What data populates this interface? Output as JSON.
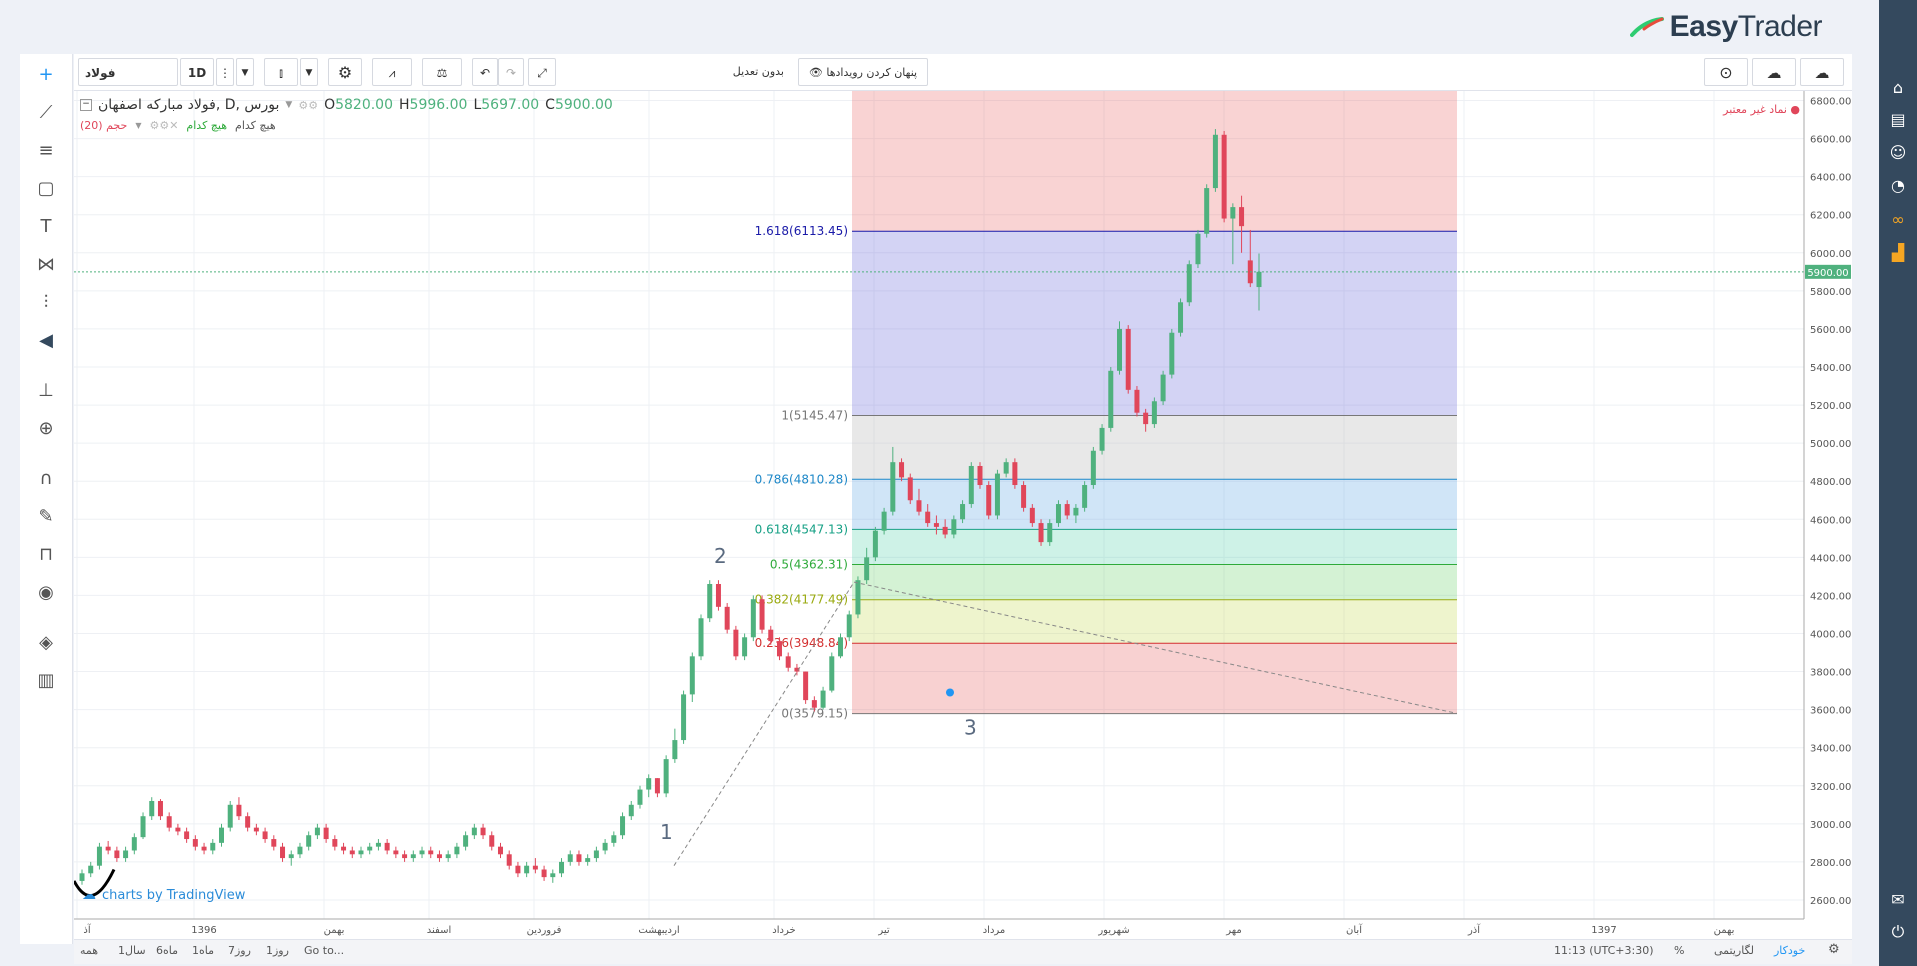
{
  "app": {
    "brand_light": "Easy",
    "brand_bold": "Trader",
    "brand_color": "#2c3e50"
  },
  "toolbar": {
    "symbol": "فولاد",
    "interval": "1D",
    "adjust_label": "بدون تعدیل",
    "hide_events_label": "پنهان کردن رویدادها"
  },
  "legend": {
    "title": "فولاد مبارکه اصفهان, D, بورس",
    "open_label": "O",
    "open": "5820.00",
    "high_label": "H",
    "high": "5996.00",
    "low_label": "L",
    "low": "5697.00",
    "close_label": "C",
    "close": "5900.00",
    "volume_label": "حجم (20)",
    "volume_a": "هیچ کدام",
    "volume_b": "هیچ کدام",
    "invalid_symbol": "نماد غیر معتبر"
  },
  "watermark": "charts by TradingView",
  "waves": [
    "1",
    "2",
    "3"
  ],
  "chart_data": {
    "type": "candlestick",
    "ylim": [
      2500,
      6850
    ],
    "y_ticks": [
      2600,
      2800,
      3000,
      3200,
      3400,
      3600,
      3800,
      4000,
      4200,
      4400,
      4600,
      4800,
      5000,
      5200,
      5400,
      5600,
      5800,
      6000,
      6200,
      6400,
      6600,
      6800
    ],
    "y_tick_labels": [
      "2600.00",
      "2800.00",
      "3000.00",
      "3200.00",
      "3400.00",
      "3600.00",
      "3800.00",
      "4000.00",
      "4200.00",
      "4400.00",
      "4600.00",
      "4800.00",
      "5000.00",
      "5200.00",
      "5400.00",
      "5600.00",
      "5800.00",
      "6000.00",
      "6200.00",
      "6400.00",
      "6600.00",
      "6800.00"
    ],
    "last_price": 5900,
    "last_price_label": "5900.00",
    "x_labels": [
      "آذ",
      "1396",
      "بهمن",
      "اسفند",
      "فروردین",
      "اردیبهشت",
      "خرداد",
      "تیر",
      "مرداد",
      "شهریور",
      "مهر",
      "آبان",
      "آذر",
      "1397",
      "بهمن"
    ],
    "fibonacci": [
      {
        "label": "1.618(6113.45)",
        "value": 6113.45,
        "color": "#1a1aa8"
      },
      {
        "label": "1(5145.47)",
        "value": 5145.47,
        "color": "#777777"
      },
      {
        "label": "0.786(4810.28)",
        "value": 4810.28,
        "color": "#1e88c8"
      },
      {
        "label": "0.618(4547.13)",
        "value": 4547.13,
        "color": "#16a085"
      },
      {
        "label": "0.5(4362.31)",
        "value": 4362.31,
        "color": "#2eaa3a"
      },
      {
        "label": "0.382(4177.49)",
        "value": 4177.49,
        "color": "#9aaa10"
      },
      {
        "label": "0.236(3948.84)",
        "value": 3948.84,
        "color": "#d32f2f"
      },
      {
        "label": "0(3579.15)",
        "value": 3579.15,
        "color": "#777777"
      }
    ],
    "candles": [
      [
        2700,
        2760,
        2680,
        2740
      ],
      [
        2740,
        2800,
        2720,
        2780
      ],
      [
        2780,
        2900,
        2760,
        2880
      ],
      [
        2880,
        2910,
        2840,
        2860
      ],
      [
        2860,
        2880,
        2800,
        2820
      ],
      [
        2820,
        2880,
        2800,
        2860
      ],
      [
        2860,
        2950,
        2840,
        2930
      ],
      [
        2930,
        3060,
        2920,
        3040
      ],
      [
        3040,
        3140,
        3020,
        3120
      ],
      [
        3120,
        3130,
        3020,
        3040
      ],
      [
        3040,
        3060,
        2960,
        2980
      ],
      [
        2980,
        3000,
        2940,
        2960
      ],
      [
        2960,
        2980,
        2900,
        2920
      ],
      [
        2920,
        2940,
        2860,
        2880
      ],
      [
        2880,
        2900,
        2840,
        2860
      ],
      [
        2860,
        2920,
        2840,
        2900
      ],
      [
        2900,
        3000,
        2880,
        2980
      ],
      [
        2980,
        3120,
        2960,
        3100
      ],
      [
        3100,
        3140,
        3020,
        3040
      ],
      [
        3040,
        3060,
        2960,
        2980
      ],
      [
        2980,
        3000,
        2940,
        2960
      ],
      [
        2960,
        2980,
        2900,
        2920
      ],
      [
        2920,
        2940,
        2860,
        2880
      ],
      [
        2880,
        2900,
        2800,
        2820
      ],
      [
        2820,
        2860,
        2780,
        2840
      ],
      [
        2840,
        2900,
        2820,
        2880
      ],
      [
        2880,
        2960,
        2860,
        2940
      ],
      [
        2940,
        3000,
        2920,
        2980
      ],
      [
        2980,
        3000,
        2900,
        2920
      ],
      [
        2920,
        2940,
        2860,
        2880
      ],
      [
        2880,
        2900,
        2840,
        2860
      ],
      [
        2860,
        2880,
        2820,
        2840
      ],
      [
        2840,
        2880,
        2820,
        2860
      ],
      [
        2860,
        2900,
        2840,
        2880
      ],
      [
        2880,
        2920,
        2860,
        2900
      ],
      [
        2900,
        2920,
        2840,
        2860
      ],
      [
        2860,
        2880,
        2820,
        2840
      ],
      [
        2840,
        2860,
        2800,
        2820
      ],
      [
        2820,
        2860,
        2800,
        2840
      ],
      [
        2840,
        2880,
        2820,
        2860
      ],
      [
        2860,
        2880,
        2820,
        2840
      ],
      [
        2840,
        2860,
        2800,
        2820
      ],
      [
        2820,
        2860,
        2800,
        2840
      ],
      [
        2840,
        2900,
        2820,
        2880
      ],
      [
        2880,
        2960,
        2860,
        2940
      ],
      [
        2940,
        3000,
        2920,
        2980
      ],
      [
        2980,
        3000,
        2920,
        2940
      ],
      [
        2940,
        2960,
        2860,
        2880
      ],
      [
        2880,
        2900,
        2820,
        2840
      ],
      [
        2840,
        2860,
        2760,
        2780
      ],
      [
        2780,
        2800,
        2720,
        2740
      ],
      [
        2740,
        2800,
        2720,
        2780
      ],
      [
        2780,
        2820,
        2740,
        2760
      ],
      [
        2760,
        2780,
        2700,
        2720
      ],
      [
        2720,
        2760,
        2690,
        2740
      ],
      [
        2740,
        2820,
        2720,
        2800
      ],
      [
        2800,
        2860,
        2780,
        2840
      ],
      [
        2840,
        2860,
        2780,
        2800
      ],
      [
        2800,
        2840,
        2780,
        2820
      ],
      [
        2820,
        2880,
        2800,
        2860
      ],
      [
        2860,
        2920,
        2840,
        2900
      ],
      [
        2900,
        2960,
        2880,
        2940
      ],
      [
        2940,
        3060,
        2920,
        3040
      ],
      [
        3040,
        3120,
        3020,
        3100
      ],
      [
        3100,
        3200,
        3080,
        3180
      ],
      [
        3180,
        3260,
        3140,
        3240
      ],
      [
        3240,
        3240,
        3140,
        3160
      ],
      [
        3160,
        3360,
        3140,
        3340
      ],
      [
        3340,
        3500,
        3320,
        3440
      ],
      [
        3440,
        3700,
        3420,
        3680
      ],
      [
        3680,
        3900,
        3640,
        3880
      ],
      [
        3880,
        4100,
        3860,
        4080
      ],
      [
        4080,
        4280,
        4060,
        4260
      ],
      [
        4260,
        4280,
        4120,
        4140
      ],
      [
        4140,
        4160,
        4000,
        4020
      ],
      [
        4020,
        4040,
        3860,
        3880
      ],
      [
        3880,
        4000,
        3860,
        3980
      ],
      [
        3980,
        4200,
        3960,
        4180
      ],
      [
        4180,
        4200,
        4000,
        4020
      ],
      [
        4020,
        4040,
        3940,
        3960
      ],
      [
        3960,
        3980,
        3860,
        3880
      ],
      [
        3880,
        3900,
        3800,
        3820
      ],
      [
        3820,
        3840,
        3780,
        3800
      ],
      [
        3800,
        3800,
        3630,
        3650
      ],
      [
        3650,
        3670,
        3590,
        3610
      ],
      [
        3610,
        3720,
        3600,
        3700
      ],
      [
        3700,
        3900,
        3690,
        3880
      ],
      [
        3880,
        4000,
        3870,
        3980
      ],
      [
        3980,
        4120,
        3960,
        4100
      ],
      [
        4100,
        4300,
        4080,
        4280
      ],
      [
        4280,
        4450,
        4260,
        4400
      ],
      [
        4400,
        4560,
        4380,
        4540
      ],
      [
        4540,
        4660,
        4520,
        4640
      ],
      [
        4640,
        4980,
        4620,
        4900
      ],
      [
        4900,
        4920,
        4800,
        4820
      ],
      [
        4820,
        4840,
        4680,
        4700
      ],
      [
        4700,
        4760,
        4620,
        4640
      ],
      [
        4640,
        4680,
        4560,
        4580
      ],
      [
        4580,
        4620,
        4520,
        4560
      ],
      [
        4560,
        4600,
        4500,
        4520
      ],
      [
        4520,
        4620,
        4500,
        4600
      ],
      [
        4600,
        4700,
        4580,
        4680
      ],
      [
        4680,
        4900,
        4660,
        4880
      ],
      [
        4880,
        4900,
        4760,
        4780
      ],
      [
        4780,
        4800,
        4600,
        4620
      ],
      [
        4620,
        4860,
        4600,
        4840
      ],
      [
        4840,
        4920,
        4820,
        4900
      ],
      [
        4900,
        4920,
        4760,
        4780
      ],
      [
        4780,
        4800,
        4640,
        4660
      ],
      [
        4660,
        4680,
        4560,
        4580
      ],
      [
        4580,
        4600,
        4460,
        4480
      ],
      [
        4480,
        4600,
        4460,
        4580
      ],
      [
        4580,
        4700,
        4560,
        4680
      ],
      [
        4680,
        4700,
        4600,
        4620
      ],
      [
        4620,
        4680,
        4580,
        4660
      ],
      [
        4660,
        4800,
        4640,
        4780
      ],
      [
        4780,
        4980,
        4760,
        4960
      ],
      [
        4960,
        5100,
        4940,
        5080
      ],
      [
        5080,
        5400,
        5060,
        5380
      ],
      [
        5380,
        5640,
        5360,
        5600
      ],
      [
        5600,
        5620,
        5260,
        5280
      ],
      [
        5280,
        5300,
        5140,
        5160
      ],
      [
        5160,
        5180,
        5060,
        5100
      ],
      [
        5100,
        5240,
        5080,
        5220
      ],
      [
        5220,
        5380,
        5200,
        5360
      ],
      [
        5360,
        5600,
        5340,
        5580
      ],
      [
        5580,
        5760,
        5560,
        5740
      ],
      [
        5740,
        5960,
        5720,
        5940
      ],
      [
        5940,
        6120,
        5920,
        6100
      ],
      [
        6100,
        6360,
        6080,
        6340
      ],
      [
        6340,
        6650,
        6320,
        6620
      ],
      [
        6620,
        6640,
        6160,
        6180
      ],
      [
        6180,
        6260,
        5940,
        6240
      ],
      [
        6240,
        6300,
        6000,
        6140
      ],
      [
        5960,
        6120,
        5820,
        5840
      ],
      [
        5820,
        5996,
        5697,
        5900
      ]
    ]
  },
  "bottom": {
    "ranges": [
      "همه",
      "1سال",
      "6ماه",
      "1ماه",
      "7روز",
      "1روز"
    ],
    "goto": "Go to...",
    "time": "11:13 (UTC+3:30)",
    "percent": "%",
    "log": "لگاریتمی",
    "auto": "خودکار"
  },
  "colors": {
    "up": "#4fb17e",
    "down": "#e0465a",
    "sidebar": "#34495e",
    "accent": "#2196f3"
  }
}
